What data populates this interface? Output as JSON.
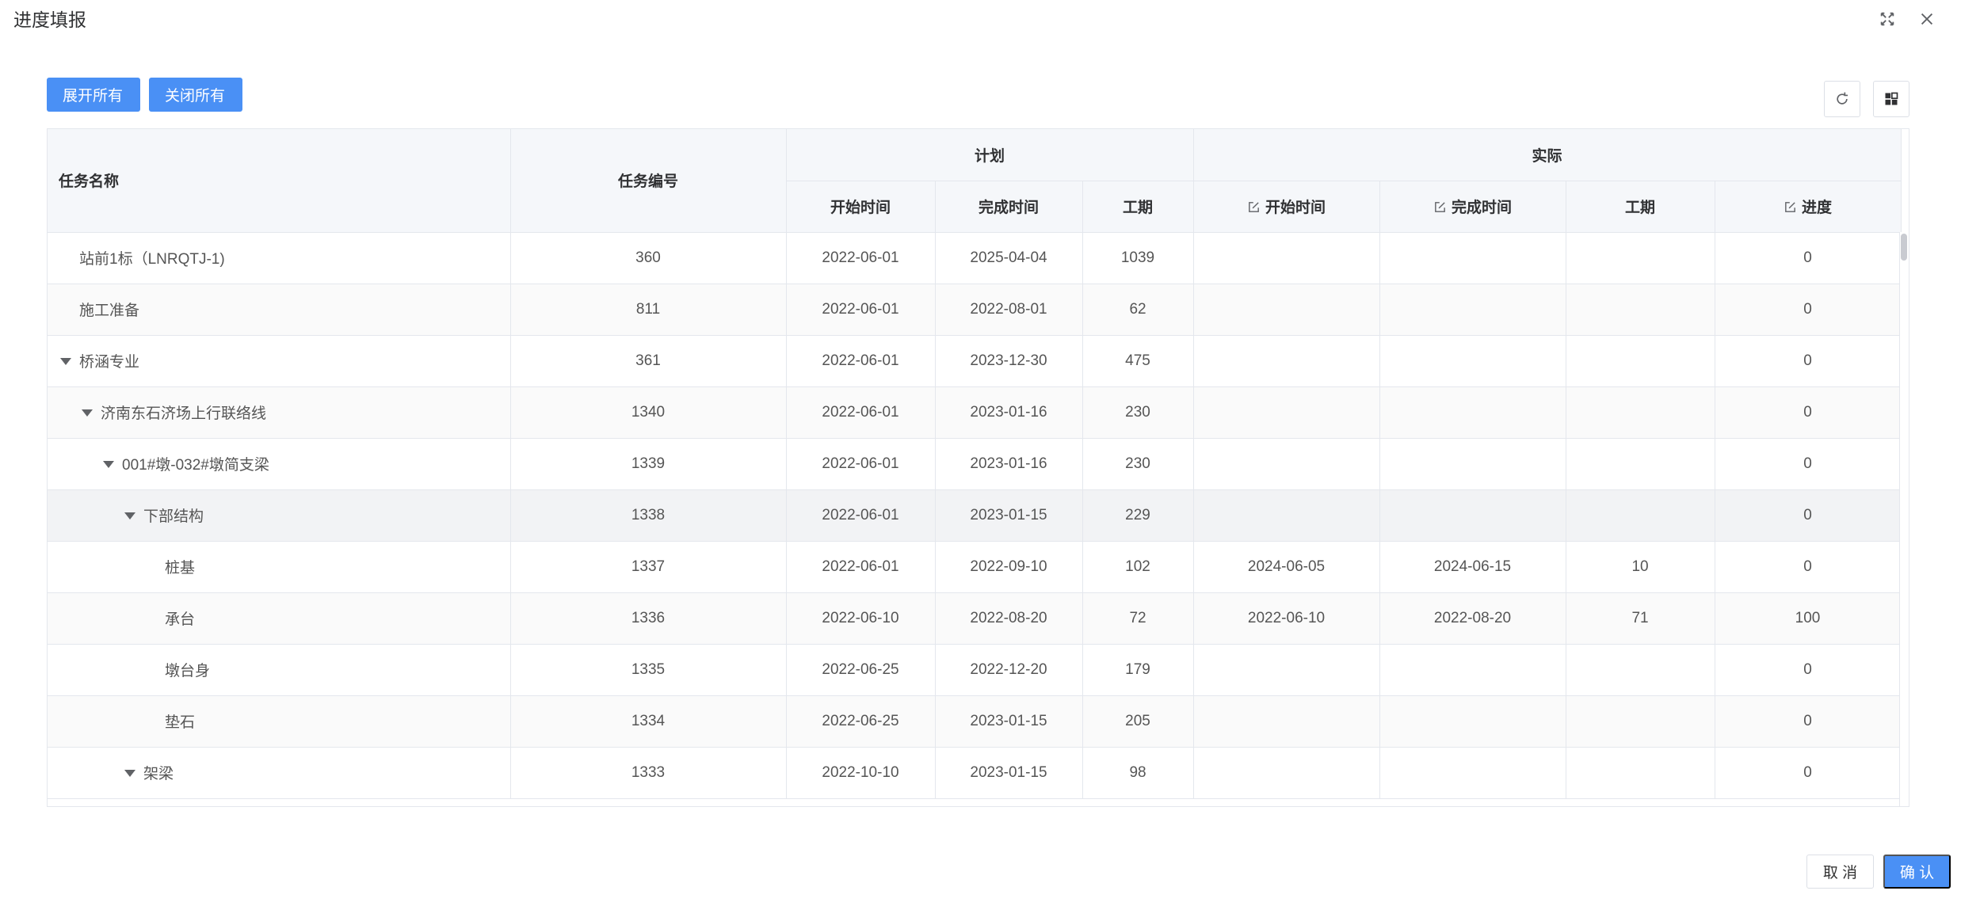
{
  "dialog": {
    "title": "进度填报"
  },
  "toolbar": {
    "expand_all": "展开所有",
    "collapse_all": "关闭所有"
  },
  "columns": {
    "task_name": "任务名称",
    "task_no": "任务编号",
    "plan": "计划",
    "actual": "实际",
    "plan_start": "开始时间",
    "plan_end": "完成时间",
    "plan_duration": "工期",
    "actual_start": "开始时间",
    "actual_end": "完成时间",
    "actual_duration": "工期",
    "progress": "进度"
  },
  "rows": [
    {
      "name": "站前1标（LNRQTJ-1)",
      "level": 0,
      "expandable": false,
      "no": "360",
      "plan_start": "2022-06-01",
      "plan_end": "2025-04-04",
      "plan_duration": "1039",
      "actual_start": "",
      "actual_end": "",
      "actual_duration": "",
      "progress": "0"
    },
    {
      "name": "施工准备",
      "level": 0,
      "expandable": false,
      "no": "811",
      "plan_start": "2022-06-01",
      "plan_end": "2022-08-01",
      "plan_duration": "62",
      "actual_start": "",
      "actual_end": "",
      "actual_duration": "",
      "progress": "0"
    },
    {
      "name": "桥涵专业",
      "level": 0,
      "expandable": true,
      "no": "361",
      "plan_start": "2022-06-01",
      "plan_end": "2023-12-30",
      "plan_duration": "475",
      "actual_start": "",
      "actual_end": "",
      "actual_duration": "",
      "progress": "0"
    },
    {
      "name": "济南东石济场上行联络线",
      "level": 1,
      "expandable": true,
      "no": "1340",
      "plan_start": "2022-06-01",
      "plan_end": "2023-01-16",
      "plan_duration": "230",
      "actual_start": "",
      "actual_end": "",
      "actual_duration": "",
      "progress": "0"
    },
    {
      "name": "001#墩-032#墩简支梁",
      "level": 2,
      "expandable": true,
      "no": "1339",
      "plan_start": "2022-06-01",
      "plan_end": "2023-01-16",
      "plan_duration": "230",
      "actual_start": "",
      "actual_end": "",
      "actual_duration": "",
      "progress": "0"
    },
    {
      "name": "下部结构",
      "level": 3,
      "expandable": true,
      "no": "1338",
      "plan_start": "2022-06-01",
      "plan_end": "2023-01-15",
      "plan_duration": "229",
      "actual_start": "",
      "actual_end": "",
      "actual_duration": "",
      "progress": "0"
    },
    {
      "name": "桩基",
      "level": 4,
      "expandable": false,
      "no": "1337",
      "plan_start": "2022-06-01",
      "plan_end": "2022-09-10",
      "plan_duration": "102",
      "actual_start": "2024-06-05",
      "actual_end": "2024-06-15",
      "actual_duration": "10",
      "progress": "0"
    },
    {
      "name": "承台",
      "level": 4,
      "expandable": false,
      "no": "1336",
      "plan_start": "2022-06-10",
      "plan_end": "2022-08-20",
      "plan_duration": "72",
      "actual_start": "2022-06-10",
      "actual_end": "2022-08-20",
      "actual_duration": "71",
      "progress": "100"
    },
    {
      "name": "墩台身",
      "level": 4,
      "expandable": false,
      "no": "1335",
      "plan_start": "2022-06-25",
      "plan_end": "2022-12-20",
      "plan_duration": "179",
      "actual_start": "",
      "actual_end": "",
      "actual_duration": "",
      "progress": "0"
    },
    {
      "name": "垫石",
      "level": 4,
      "expandable": false,
      "no": "1334",
      "plan_start": "2022-06-25",
      "plan_end": "2023-01-15",
      "plan_duration": "205",
      "actual_start": "",
      "actual_end": "",
      "actual_duration": "",
      "progress": "0"
    },
    {
      "name": "架梁",
      "level": 3,
      "expandable": true,
      "no": "1333",
      "plan_start": "2022-10-10",
      "plan_end": "2023-01-15",
      "plan_duration": "98",
      "actual_start": "",
      "actual_end": "",
      "actual_duration": "",
      "progress": "0"
    }
  ],
  "footer": {
    "cancel": "取 消",
    "confirm": "确 认"
  }
}
